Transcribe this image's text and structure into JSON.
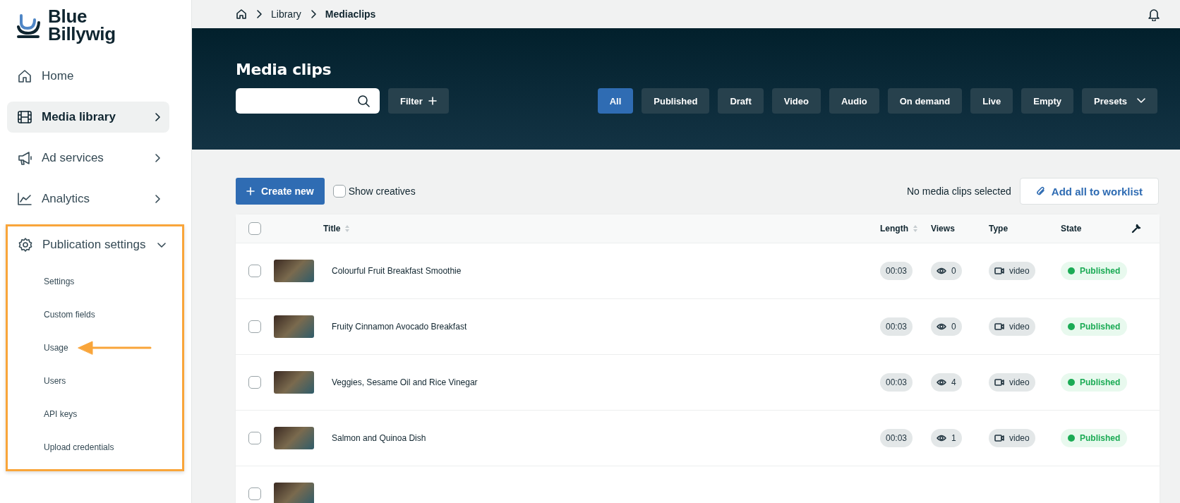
{
  "logo": {
    "line1": "Blue",
    "line2": "Billywig"
  },
  "sidebar": {
    "items": [
      {
        "label": "Home",
        "kind": "link",
        "selected": false
      },
      {
        "label": "Media library",
        "kind": "menu",
        "selected": true
      },
      {
        "label": "Ad services",
        "kind": "menu",
        "selected": false
      },
      {
        "label": "Analytics",
        "kind": "menu",
        "selected": false
      },
      {
        "label": "Publication settings",
        "kind": "menu",
        "selected": false,
        "expanded": true,
        "highlighted": true,
        "children": [
          {
            "label": "Settings",
            "annotated": false
          },
          {
            "label": "Custom fields",
            "annotated": false
          },
          {
            "label": "Usage",
            "annotated": true
          },
          {
            "label": "Users",
            "annotated": false
          },
          {
            "label": "API keys",
            "annotated": false
          },
          {
            "label": "Upload credentials",
            "annotated": false
          }
        ]
      }
    ]
  },
  "breadcrumb": [
    "Library",
    "Mediaclips"
  ],
  "hero": {
    "title": "Media clips",
    "filter_button": "Filter",
    "chips": [
      {
        "label": "All",
        "selected": true,
        "kind": "chip"
      },
      {
        "label": "Published",
        "selected": false,
        "kind": "chip"
      },
      {
        "label": "Draft",
        "selected": false,
        "kind": "chip"
      },
      {
        "label": "Video",
        "selected": false,
        "kind": "chip"
      },
      {
        "label": "Audio",
        "selected": false,
        "kind": "chip"
      },
      {
        "label": "On demand",
        "selected": false,
        "kind": "chip"
      },
      {
        "label": "Live",
        "selected": false,
        "kind": "chip"
      },
      {
        "label": "Empty",
        "selected": false,
        "kind": "chip"
      },
      {
        "label": "Presets",
        "selected": false,
        "kind": "dropdown"
      }
    ]
  },
  "toolbar": {
    "create_button": "Create new",
    "show_creatives": {
      "label": "Show creatives",
      "checked": false
    },
    "selection_status": "No media clips selected",
    "worklist_button": "Add all to worklist"
  },
  "table": {
    "select_all": {
      "checked": false
    },
    "columns": [
      {
        "label": "Title",
        "sortable": true
      },
      {
        "label": "Length",
        "sortable": true
      },
      {
        "label": "Views",
        "sortable": false
      },
      {
        "label": "Type",
        "sortable": false
      },
      {
        "label": "State",
        "sortable": false
      }
    ],
    "rows": [
      {
        "checked": false,
        "title": "Colourful Fruit Breakfast Smoothie",
        "length": "00:03",
        "views": "0",
        "type": "video",
        "state": "Published"
      },
      {
        "checked": false,
        "title": "Fruity Cinnamon Avocado Breakfast",
        "length": "00:03",
        "views": "0",
        "type": "video",
        "state": "Published"
      },
      {
        "checked": false,
        "title": "Veggies, Sesame Oil and Rice Vinegar",
        "length": "00:03",
        "views": "4",
        "type": "video",
        "state": "Published"
      },
      {
        "checked": false,
        "title": "Salmon and Quinoa Dish",
        "length": "00:03",
        "views": "1",
        "type": "video",
        "state": "Published"
      },
      {
        "checked": false
      }
    ]
  }
}
